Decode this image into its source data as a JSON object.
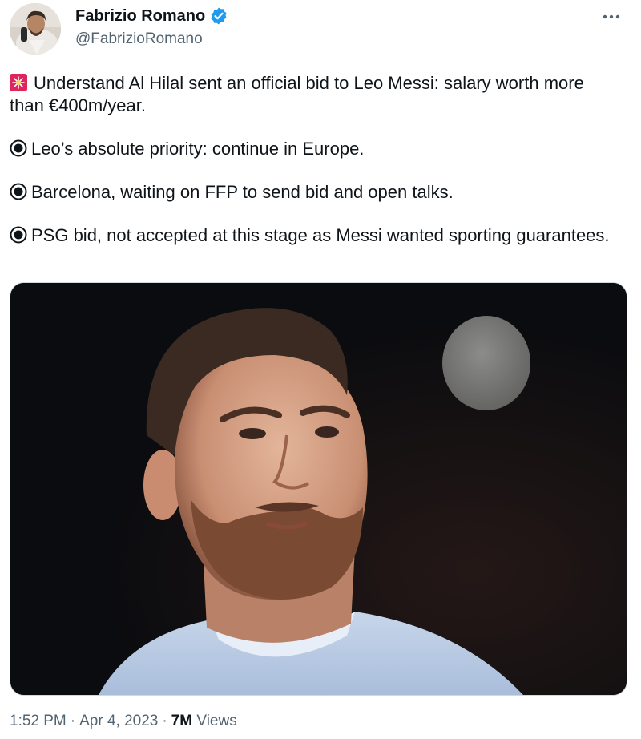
{
  "author": {
    "name": "Fabrizio Romano",
    "handle": "@FabrizioRomano",
    "verified": true
  },
  "tweet": {
    "paragraphs": [
      {
        "icon": "siren-icon",
        "text": "Understand Al Hilal sent an official bid to Leo Messi: salary worth more than €400m/year."
      },
      {
        "icon": "bullet-icon",
        "text": "Leo’s absolute priority: continue in Europe."
      },
      {
        "icon": "bullet-icon",
        "text": "Barcelona, waiting on FFP to send bid and open talks."
      },
      {
        "icon": "bullet-icon",
        "text": "PSG bid, not accepted at this stage as Messi wanted sporting guarantees."
      }
    ]
  },
  "meta": {
    "time": "1:52 PM",
    "date": "Apr 4, 2023",
    "views_count": "7M",
    "views_label": "Views",
    "separator": "·"
  },
  "colors": {
    "text": "#0f1419",
    "secondary_text": "#536471",
    "verified_badge": "#1d9bf0",
    "siren_red": "#e0245e",
    "image_background": "#0c0d10"
  }
}
